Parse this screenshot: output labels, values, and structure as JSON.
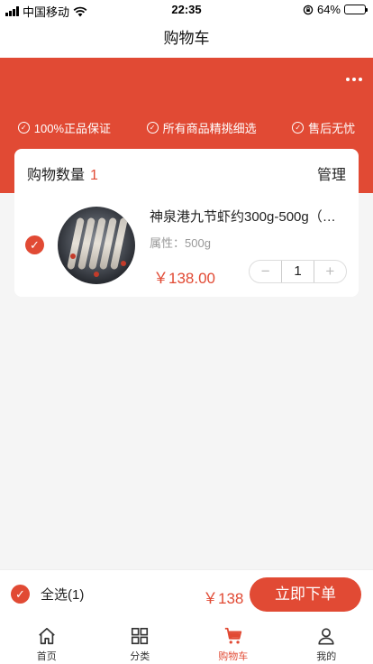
{
  "status_bar": {
    "carrier": "中国移动",
    "time": "22:35",
    "battery": "64%",
    "battery_level": 0.64
  },
  "header": {
    "title": "购物车"
  },
  "guarantees": [
    "100%正品保证",
    "所有商品精挑细选",
    "售后无忧"
  ],
  "cart": {
    "count_label": "购物数量",
    "count": "1",
    "manage_label": "管理",
    "items": [
      {
        "title": "神泉港九节虾约300g-500g（…",
        "attr": "属性：500g",
        "price": "￥138.00",
        "quantity": "1",
        "checked": true
      }
    ]
  },
  "bottom": {
    "select_all_label": "全选(1)",
    "total": "￥138",
    "checkout_label": "立即下单"
  },
  "tabs": [
    {
      "label": "首页",
      "icon": "home-icon",
      "active": false
    },
    {
      "label": "分类",
      "icon": "category-icon",
      "active": false
    },
    {
      "label": "购物车",
      "icon": "cart-icon",
      "active": true
    },
    {
      "label": "我的",
      "icon": "user-icon",
      "active": false
    }
  ],
  "colors": {
    "accent": "#e14a34",
    "background": "#f5f5f5"
  },
  "icons": {
    "status": [
      "signal-icon",
      "wifi-icon",
      "lock-rotation-icon",
      "battery-icon"
    ],
    "more": "more-dots-icon",
    "guarantee": "circle-check-icon",
    "item_check": "check-circle-icon",
    "stepper": [
      "minus-icon",
      "plus-icon"
    ]
  }
}
